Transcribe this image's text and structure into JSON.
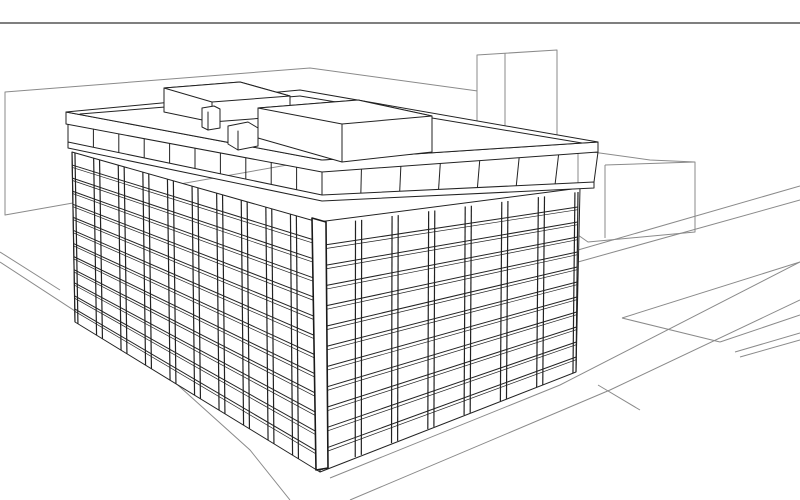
{
  "scene": {
    "subject": "building-icon",
    "style": "line-drawing",
    "colors": {
      "background": "#ffffff",
      "line": "#222222",
      "context_line": "#8a8a8a",
      "frame_line": "#333333"
    },
    "building": {
      "left_facade": {
        "bays": 10,
        "floors": 13
      },
      "right_facade": {
        "bays": 7,
        "floors": 12
      }
    }
  }
}
